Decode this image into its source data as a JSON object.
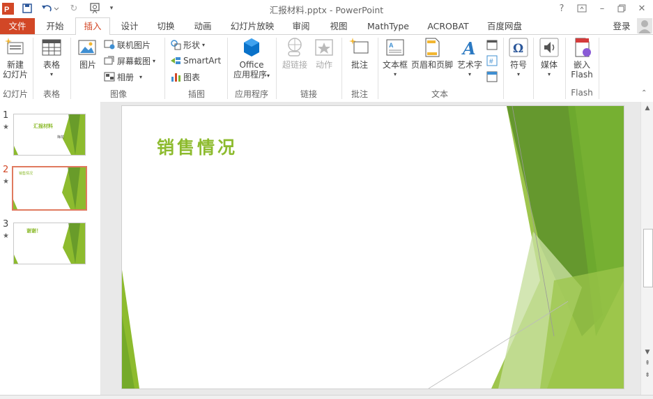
{
  "window": {
    "title": "汇报材料.pptx - PowerPoint",
    "help": "?",
    "login": "登录"
  },
  "tabs": [
    {
      "label": "文件"
    },
    {
      "label": "开始"
    },
    {
      "label": "插入"
    },
    {
      "label": "设计"
    },
    {
      "label": "切换"
    },
    {
      "label": "动画"
    },
    {
      "label": "幻灯片放映"
    },
    {
      "label": "审阅"
    },
    {
      "label": "视图"
    },
    {
      "label": "MathType"
    },
    {
      "label": "ACROBAT"
    },
    {
      "label": "百度网盘"
    }
  ],
  "ribbon": {
    "slides": {
      "new_slide": "新建",
      "new_slide2": "幻灯片",
      "group": "幻灯片"
    },
    "tables": {
      "table": "表格",
      "group": "表格"
    },
    "images": {
      "picture": "图片",
      "online": "联机图片",
      "screenshot": "屏幕截图",
      "album": "相册",
      "group": "图像"
    },
    "illustrations": {
      "shapes": "形状",
      "smartart": "SmartArt",
      "chart": "图表",
      "group": "插图"
    },
    "apps": {
      "office": "Office",
      "office2": "应用程序",
      "group": "应用程序"
    },
    "links": {
      "hyperlink": "超链接",
      "action": "动作",
      "group": "链接"
    },
    "comments": {
      "comment": "批注",
      "group": "批注"
    },
    "text": {
      "textbox": "文本框",
      "header": "页眉和页脚",
      "wordart": "艺术字",
      "group": "文本"
    },
    "symbols": {
      "symbol": "符号"
    },
    "media": {
      "media": "媒体"
    },
    "flash": {
      "embed": "嵌入",
      "flash": "Flash",
      "group": "Flash"
    }
  },
  "slides": [
    {
      "number": "1",
      "title": "汇报材料",
      "subtitle": "梅花"
    },
    {
      "number": "2",
      "title": "销售情况"
    },
    {
      "number": "3",
      "title": "谢谢！"
    }
  ],
  "current_slide": {
    "title": "销售情况"
  },
  "colors": {
    "accent": "#d24726",
    "slide_green": "#8dbb2e"
  }
}
